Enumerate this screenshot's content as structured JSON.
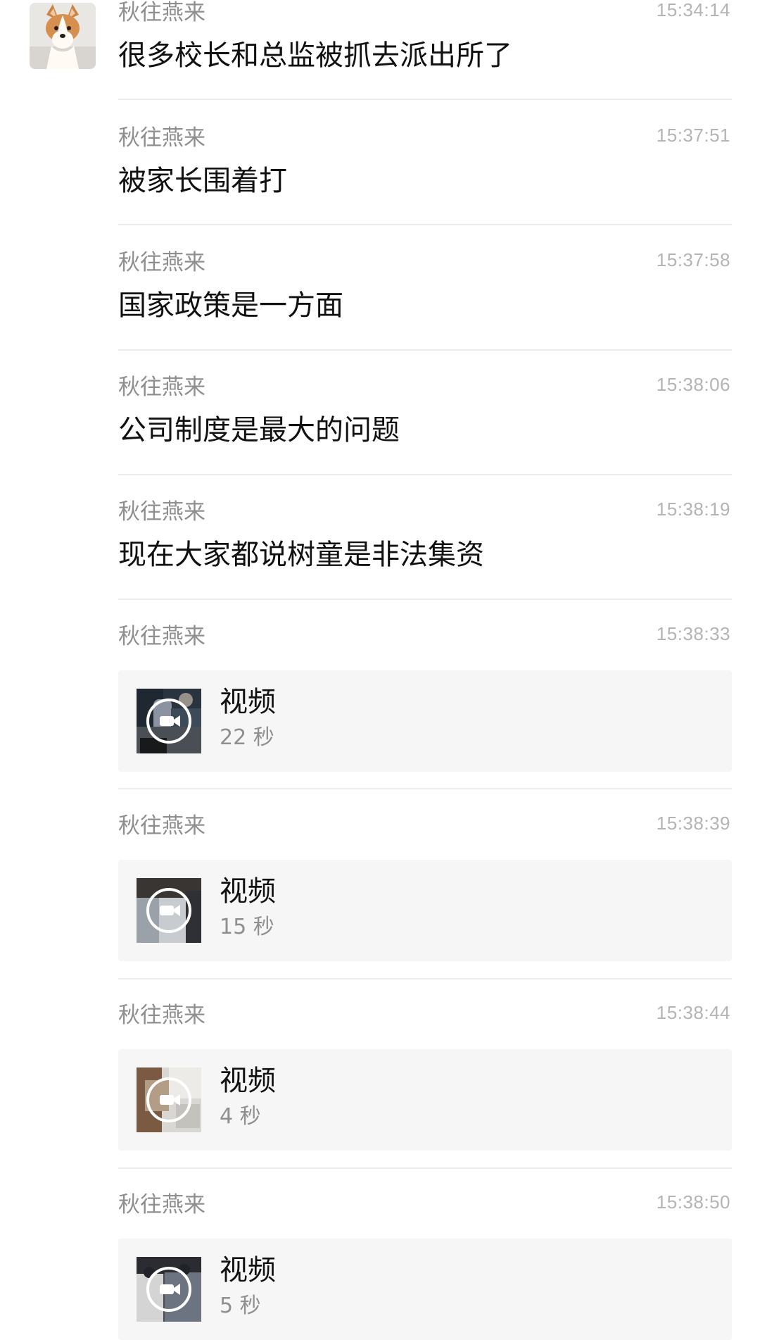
{
  "messages": [
    {
      "sender": "秋往燕来",
      "time": "15:34:14",
      "text": "很多校长和总监被抓去派出所了"
    },
    {
      "sender": "秋往燕来",
      "time": "15:37:51",
      "text": "被家长围着打"
    },
    {
      "sender": "秋往燕来",
      "time": "15:37:58",
      "text": "国家政策是一方面"
    },
    {
      "sender": "秋往燕来",
      "time": "15:38:06",
      "text": "公司制度是最大的问题"
    },
    {
      "sender": "秋往燕来",
      "time": "15:38:19",
      "text": "现在大家都说树童是非法集资"
    },
    {
      "sender": "秋往燕来",
      "time": "15:38:33",
      "video_title": "视频",
      "duration": "22 秒"
    },
    {
      "sender": "秋往燕来",
      "time": "15:38:39",
      "video_title": "视频",
      "duration": "15 秒"
    },
    {
      "sender": "秋往燕来",
      "time": "15:38:44",
      "video_title": "视频",
      "duration": "4 秒"
    },
    {
      "sender": "秋往燕来",
      "time": "15:38:50",
      "video_title": "视频",
      "duration": "5 秒"
    }
  ],
  "icons": {
    "avatar": "corgi-dog-avatar",
    "video": "video-camera-icon"
  },
  "colors": {
    "background": "#ffffff",
    "sender": "#8f8f8f",
    "time": "#b4b4b4",
    "text": "#111111",
    "video_card": "#f6f6f6",
    "divider": "#ececec"
  }
}
